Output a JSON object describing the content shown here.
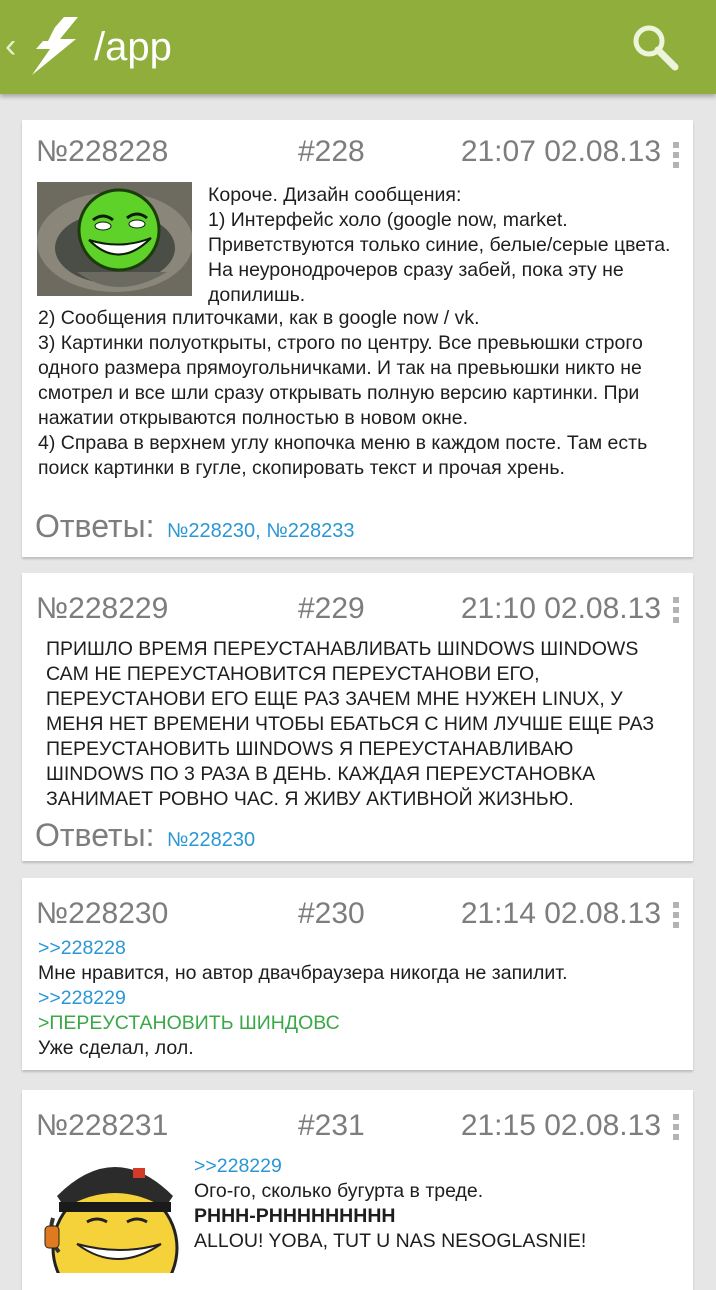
{
  "app_bar": {
    "title": "/app",
    "icons": {
      "back": "chevron-left-icon",
      "logo": "lightning-bolt-icon",
      "search": "search-icon"
    },
    "colors": {
      "bar": "#8fae3b",
      "title": "#ffffff"
    }
  },
  "colors": {
    "link": "#2a97d4",
    "greentext": "#39a846",
    "meta": "#7d7d7d",
    "background": "#e6e6e6"
  },
  "posts": [
    {
      "number": "№228228",
      "index": "#228",
      "datetime": "21:07 02.08.13",
      "text_beside": "Короче. Дизайн сообщения:\n1) Интерфейс холо (google now, market. Приветствуются только синие, белые/серые цвета. На неуронодрочеров сразу забей, пока эту не допилишь.",
      "text_below": "2) Сообщения плиточками, как в google now / vk.\n3) Картинки полуоткрыты, строго по центру. Все превьюшки строго одного размера прямоугольничками. И так на превьюшки никто не смотрел и все шли сразу открывать полную версию картинки. При нажатии открываются полностью в новом окне.\n4) Справа в верхнем углу кнопочка меню в каждом посте. Там есть поиск картинки в гугле, скопировать текст и прочая хрень.",
      "answers_label": "Ответы:",
      "answers": [
        "№228230",
        "№228233"
      ]
    },
    {
      "number": "№228229",
      "index": "#229",
      "datetime": "21:10 02.08.13",
      "text": "ПРИШЛО ВРЕМЯ ПЕРЕУСТАНАВЛИВАТЬ ШINDOWS ШINDOWS САМ НЕ ПЕРЕУСТАНОВИТСЯ ПЕРЕУСТАНОВИ ЕГО, ПЕРЕУСТАНОВИ ЕГО ЕЩЕ РАЗ ЗАЧЕМ МНЕ НУЖЕН LINUX, У МЕНЯ НЕТ ВРЕМЕНИ ЧТОБЫ ЕБАТЬСЯ С НИМ ЛУЧШЕ ЕЩЕ РАЗ ПЕРЕУСТАНОВИТЬ ШINDOWS Я ПЕРЕУСТАНАВЛИВАЮ ШINDOWS ПО 3 РАЗА В ДЕНЬ. КАЖДАЯ ПЕРЕУСТАНОВКА ЗАНИМАЕТ РОВНО ЧАС. Я ЖИВУ АКТИВНОЙ ЖИЗНЬЮ.",
      "answers_label": "Ответы:",
      "answers": [
        "№228230"
      ]
    },
    {
      "number": "№228230",
      "index": "#230",
      "datetime": "21:14 02.08.13",
      "reply1": ">>228228",
      "line1": "Мне нравится, но автор двачбраузера никогда не запилит.",
      "reply2": ">>228229",
      "greentext": ">ПЕРЕУСТАНОВИТЬ ШИНДОВС",
      "line2": "Уже сделал, лол."
    },
    {
      "number": "№228231",
      "index": "#231",
      "datetime": "21:15 02.08.13",
      "reply1": ">>228229",
      "line1": "Ого-го, сколько бугурта в треде.",
      "bold_line": "PHHH-PHHHHHHHHH",
      "line2": "ALLOU! YOBA, TUT U NAS NESOGLASNIE!"
    }
  ]
}
